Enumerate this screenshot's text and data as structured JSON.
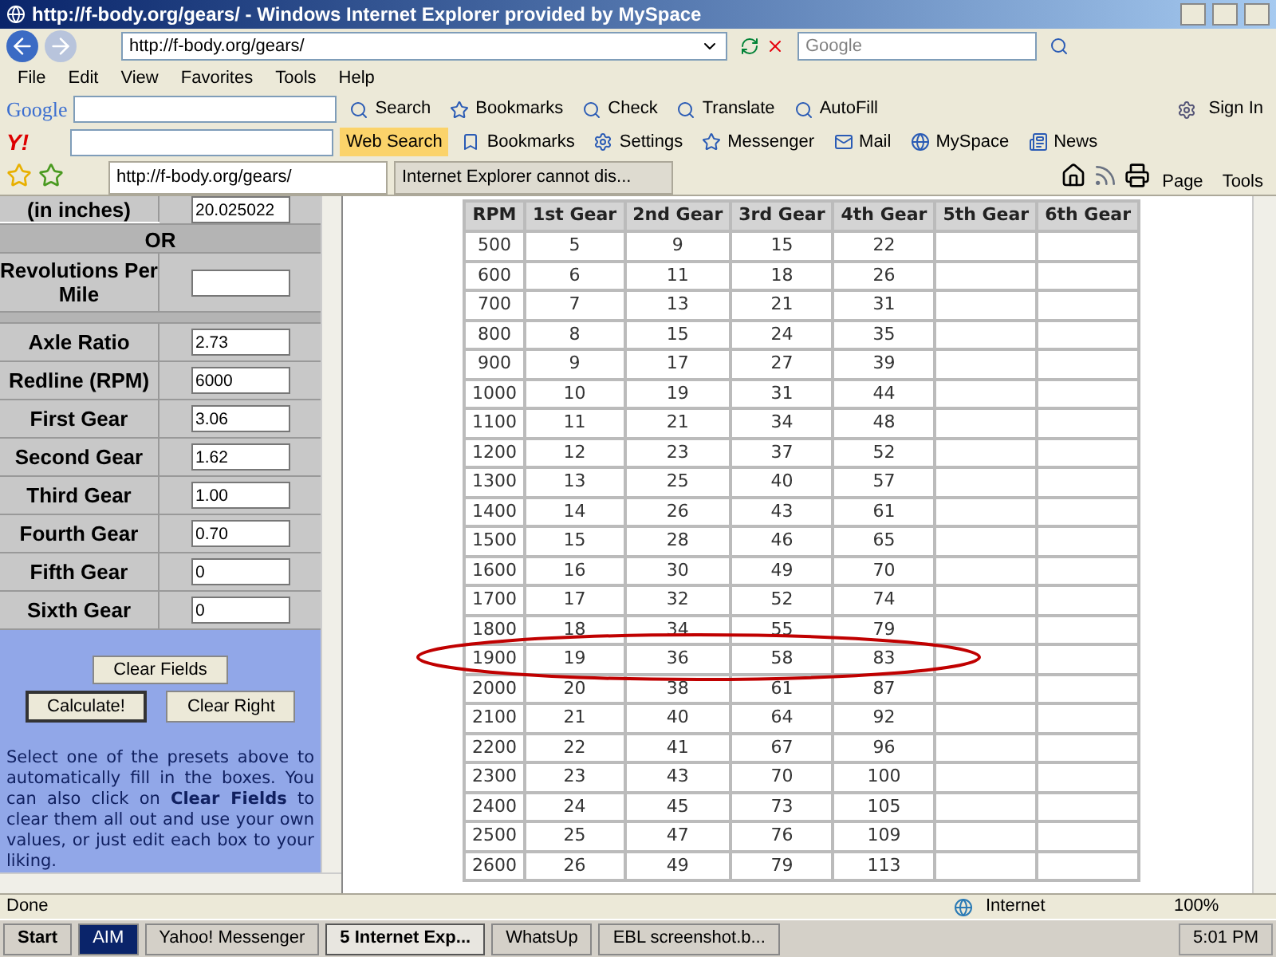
{
  "window": {
    "title": "http://f-body.org/gears/ - Windows Internet Explorer provided by MySpace"
  },
  "address_bar": {
    "value": "http://f-body.org/gears/"
  },
  "search_box": {
    "placeholder": "Google"
  },
  "menu": [
    "File",
    "Edit",
    "View",
    "Favorites",
    "Tools",
    "Help"
  ],
  "google_toolbar": {
    "logo": "Google",
    "items": [
      "Search",
      "Bookmarks",
      "Check",
      "Translate",
      "AutoFill"
    ],
    "sign_in": "Sign In"
  },
  "yahoo_toolbar": {
    "logo": "Y!",
    "button": "Web Search",
    "items": [
      "Bookmarks",
      "Settings",
      "Messenger",
      "Mail",
      "MySpace",
      "News"
    ]
  },
  "tabs": [
    {
      "label": "http://f-body.org/gears/",
      "selected": true
    },
    {
      "label": "Internet Explorer cannot dis...",
      "selected": false
    }
  ],
  "command_bar": [
    "Page",
    "Tools"
  ],
  "form": [
    {
      "kind": "field",
      "label": "(in inches)",
      "value": "20.025022"
    },
    {
      "kind": "heading",
      "label": "OR"
    },
    {
      "kind": "field",
      "label": "Revolutions Per Mile"
    },
    {
      "kind": "spacer"
    },
    {
      "kind": "field",
      "label": "Axle Ratio",
      "value": "2.73"
    },
    {
      "kind": "field",
      "label": "Redline (RPM)",
      "value": "6000"
    },
    {
      "kind": "field",
      "label": "First Gear",
      "value": "3.06"
    },
    {
      "kind": "field",
      "label": "Second Gear",
      "value": "1.62"
    },
    {
      "kind": "field",
      "label": "Third Gear",
      "value": "1.00"
    },
    {
      "kind": "field",
      "label": "Fourth Gear",
      "value": "0.70"
    },
    {
      "kind": "field",
      "label": "Fifth Gear",
      "value": "0"
    },
    {
      "kind": "field",
      "label": "Sixth Gear",
      "value": "0"
    }
  ],
  "form_buttons": {
    "clear_fields": "Clear Fields",
    "calculate": "Calculate!",
    "clear_right": "Clear Right"
  },
  "help_text": "Select one of the presets above to automatically fill in the boxes. You can also click on **Clear Fields** to clear them all out and use your own values, or just edit each box to your liking.",
  "table": {
    "columns": [
      "RPM",
      "1st Gear",
      "2nd Gear",
      "3rd Gear",
      "4th Gear",
      "5th Gear",
      "6th Gear"
    ],
    "rows": [
      {
        "cells": [
          "500",
          "5",
          "9",
          "15",
          "22"
        ],
        "circled": false
      },
      {
        "cells": [
          "600",
          "6",
          "11",
          "18",
          "26"
        ],
        "circled": false
      },
      {
        "cells": [
          "700",
          "7",
          "13",
          "21",
          "31"
        ],
        "circled": false
      },
      {
        "cells": [
          "800",
          "8",
          "15",
          "24",
          "35"
        ],
        "circled": false
      },
      {
        "cells": [
          "900",
          "9",
          "17",
          "27",
          "39"
        ],
        "circled": false
      },
      {
        "cells": [
          "1000",
          "10",
          "19",
          "31",
          "44"
        ],
        "circled": false
      },
      {
        "cells": [
          "1100",
          "11",
          "21",
          "34",
          "48"
        ],
        "circled": false
      },
      {
        "cells": [
          "1200",
          "12",
          "23",
          "37",
          "52"
        ],
        "circled": false
      },
      {
        "cells": [
          "1300",
          "13",
          "25",
          "40",
          "57"
        ],
        "circled": false
      },
      {
        "cells": [
          "1400",
          "14",
          "26",
          "43",
          "61"
        ],
        "circled": false
      },
      {
        "cells": [
          "1500",
          "15",
          "28",
          "46",
          "65"
        ],
        "circled": false
      },
      {
        "cells": [
          "1600",
          "16",
          "30",
          "49",
          "70"
        ],
        "circled": false
      },
      {
        "cells": [
          "1700",
          "17",
          "32",
          "52",
          "74"
        ],
        "circled": false
      },
      {
        "cells": [
          "1800",
          "18",
          "34",
          "55",
          "79"
        ],
        "circled": false
      },
      {
        "cells": [
          "1900",
          "19",
          "36",
          "58",
          "83"
        ],
        "circled": true
      },
      {
        "cells": [
          "2000",
          "20",
          "38",
          "61",
          "87"
        ],
        "circled": false
      },
      {
        "cells": [
          "2100",
          "21",
          "40",
          "64",
          "92"
        ],
        "circled": false
      },
      {
        "cells": [
          "2200",
          "22",
          "41",
          "67",
          "96"
        ],
        "circled": false
      },
      {
        "cells": [
          "2300",
          "23",
          "43",
          "70",
          "100"
        ],
        "circled": false
      },
      {
        "cells": [
          "2400",
          "24",
          "45",
          "73",
          "105"
        ],
        "circled": false
      },
      {
        "cells": [
          "2500",
          "25",
          "47",
          "76",
          "109"
        ],
        "circled": false
      },
      {
        "cells": [
          "2600",
          "26",
          "49",
          "79",
          "113"
        ],
        "circled": false
      }
    ]
  },
  "status_bar": {
    "text": "Done",
    "zone": "Internet",
    "zoom": "100%"
  },
  "taskbar": {
    "start": "Start",
    "items": [
      {
        "label": "AIM",
        "selected": false,
        "flashing": true
      },
      {
        "label": "Yahoo! Messenger",
        "selected": false,
        "flashing": false
      },
      {
        "label": "5 Internet Exp...",
        "selected": true,
        "flashing": false
      },
      {
        "label": "WhatsUp",
        "selected": false,
        "flashing": false
      },
      {
        "label": "EBL screenshot.b...",
        "selected": false,
        "flashing": false
      }
    ],
    "clock": "5:01 PM"
  }
}
